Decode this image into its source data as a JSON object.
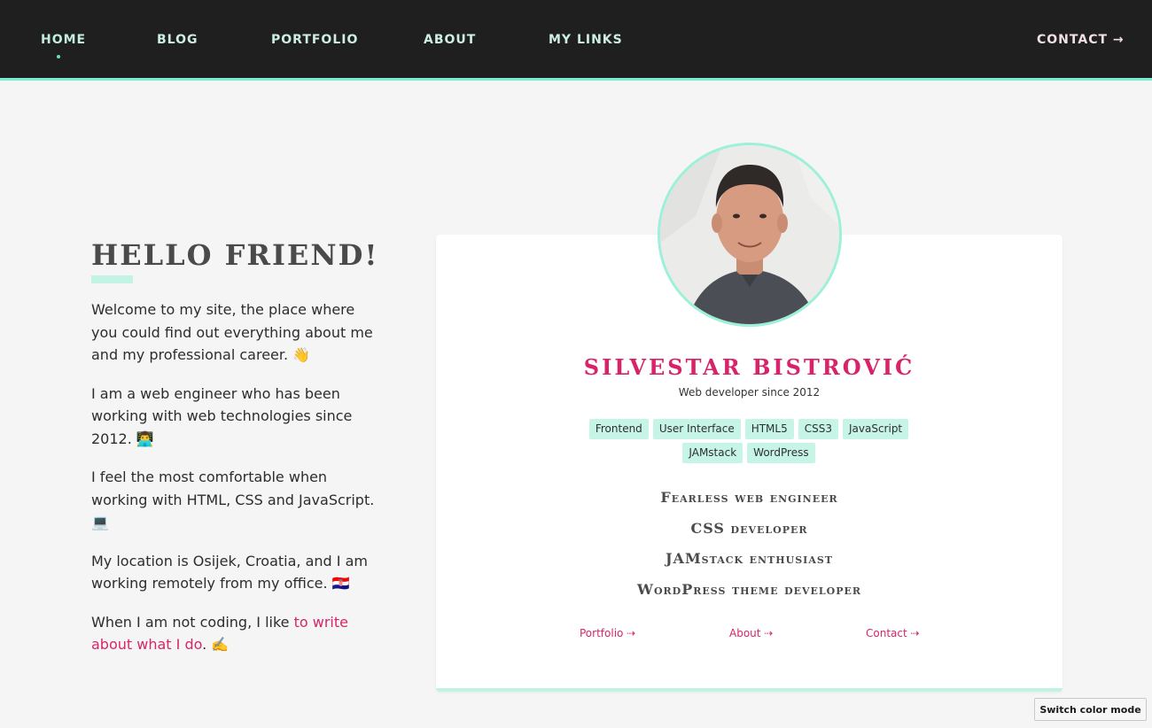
{
  "nav": {
    "items": [
      {
        "label": "HOME"
      },
      {
        "label": "BLOG"
      },
      {
        "label": "PORTFOLIO"
      },
      {
        "label": "ABOUT"
      },
      {
        "label": "MY LINKS"
      }
    ],
    "contact_label": "CONTACT →",
    "accent_color": "#7aeed0"
  },
  "intro": {
    "title": "HELLO FRIEND!",
    "paragraphs": [
      "Welcome to my site, the place where you could find out everything about me and my professional career. 👋",
      "I am a web engineer who has been working with web technologies since 2012. 👨‍💻",
      "I feel the most comfortable when working with HTML, CSS and JavaScript. 💻",
      "My location is Osijek, Croatia, and I am working remotely from my office. 🇭🇷"
    ],
    "last_prefix": "When I am not coding, I like ",
    "last_link": "to write about what I do",
    "last_suffix": ". ✍️"
  },
  "profile": {
    "name": "SILVESTAR BISTROVIĆ",
    "subtitle": "Web developer since 2012",
    "tags": [
      "Frontend",
      "User Interface",
      "HTML5",
      "CSS3",
      "JavaScript",
      "JAMstack",
      "WordPress"
    ],
    "roles": [
      "Fearless web engineer",
      "CSS developer",
      "JAMstack enthusiast",
      "WordPress theme developer"
    ],
    "links": {
      "portfolio": "Portfolio ⇢",
      "about": "About ⇢",
      "contact": "Contact ⇢"
    },
    "name_color": "#d8226a"
  },
  "mode_button": "Switch color mode"
}
